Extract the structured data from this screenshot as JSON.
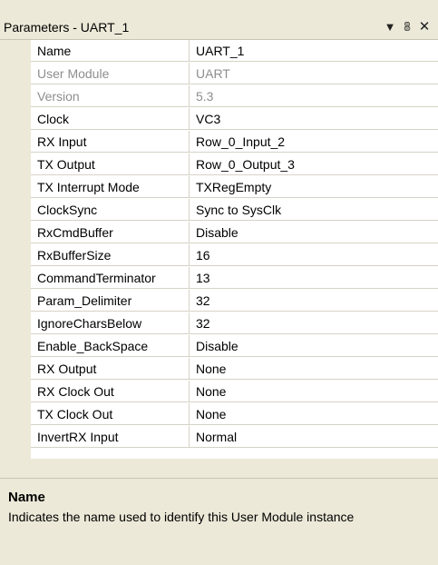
{
  "window": {
    "title": "Parameters - UART_1",
    "dropdown_icon": "dropdown-arrow",
    "pin_icon": "pin",
    "close_icon": "close"
  },
  "grid": {
    "rows": [
      {
        "name": "Name",
        "value": "UART_1",
        "readonly": false
      },
      {
        "name": "User Module",
        "value": "UART",
        "readonly": true
      },
      {
        "name": "Version",
        "value": "5.3",
        "readonly": true
      },
      {
        "name": "Clock",
        "value": "VC3",
        "readonly": false
      },
      {
        "name": "RX Input",
        "value": "Row_0_Input_2",
        "readonly": false
      },
      {
        "name": "TX Output",
        "value": "Row_0_Output_3",
        "readonly": false
      },
      {
        "name": "TX Interrupt Mode",
        "value": "TXRegEmpty",
        "readonly": false
      },
      {
        "name": "ClockSync",
        "value": "Sync to SysClk",
        "readonly": false
      },
      {
        "name": "RxCmdBuffer",
        "value": "Disable",
        "readonly": false
      },
      {
        "name": "RxBufferSize",
        "value": "16",
        "readonly": false
      },
      {
        "name": "CommandTerminator",
        "value": "13",
        "readonly": false
      },
      {
        "name": "Param_Delimiter",
        "value": "32",
        "readonly": false
      },
      {
        "name": "IgnoreCharsBelow",
        "value": "32",
        "readonly": false
      },
      {
        "name": "Enable_BackSpace",
        "value": "Disable",
        "readonly": false
      },
      {
        "name": "RX Output",
        "value": "None",
        "readonly": false
      },
      {
        "name": "RX Clock Out",
        "value": "None",
        "readonly": false
      },
      {
        "name": "TX Clock Out",
        "value": "None",
        "readonly": false
      },
      {
        "name": "InvertRX Input",
        "value": "Normal",
        "readonly": false
      }
    ]
  },
  "description": {
    "title": "Name",
    "text": "Indicates the name used to identify this User Module instance"
  }
}
